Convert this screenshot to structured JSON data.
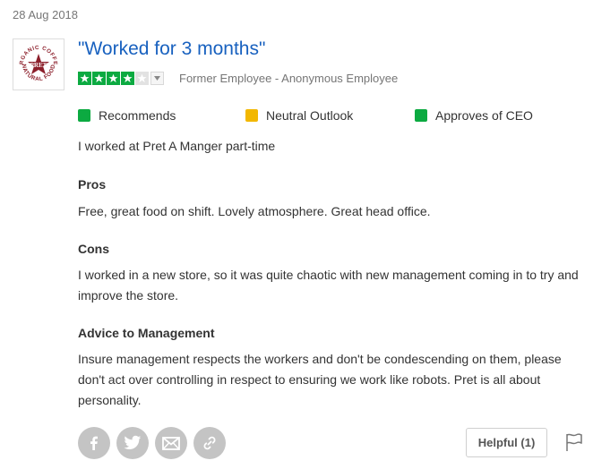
{
  "review": {
    "date": "28 Aug 2018",
    "company_logo": {
      "alt": "Pret A Manger logo",
      "ring_text_top": "ORGANIC COFFEE",
      "ring_text_bottom": "NATURAL FOOD",
      "center_text": "PRET",
      "color": "#8c1f2b"
    },
    "title": "\"Worked for 3 months\"",
    "rating": {
      "value": 4,
      "max": 5
    },
    "author": "Former Employee - Anonymous Employee",
    "outlooks": [
      {
        "label": "Recommends",
        "color": "#0caa41"
      },
      {
        "label": "Neutral Outlook",
        "color": "#f2b700"
      },
      {
        "label": "Approves of CEO",
        "color": "#0caa41"
      }
    ],
    "main_text": "I worked at Pret A Manger part-time",
    "pros_heading": "Pros",
    "pros_text": "Free, great food on shift. Lovely atmosphere. Great head office.",
    "cons_heading": "Cons",
    "cons_text": "I worked in a new store, so it was quite chaotic with new management coming in to try and improve the store.",
    "advice_heading": "Advice to Management",
    "advice_text": "Insure management respects the workers and don't be condescending on them, please don't act over controlling in respect to ensuring we work like robots. Pret is all about personality.",
    "share_icons": [
      "facebook-icon",
      "twitter-icon",
      "email-icon",
      "link-icon"
    ],
    "helpful_label": "Helpful (1)"
  },
  "colors": {
    "link_blue": "#1861bf",
    "star_green": "#0caa41",
    "muted_text": "#767676",
    "share_gray": "#c4c4c4"
  }
}
